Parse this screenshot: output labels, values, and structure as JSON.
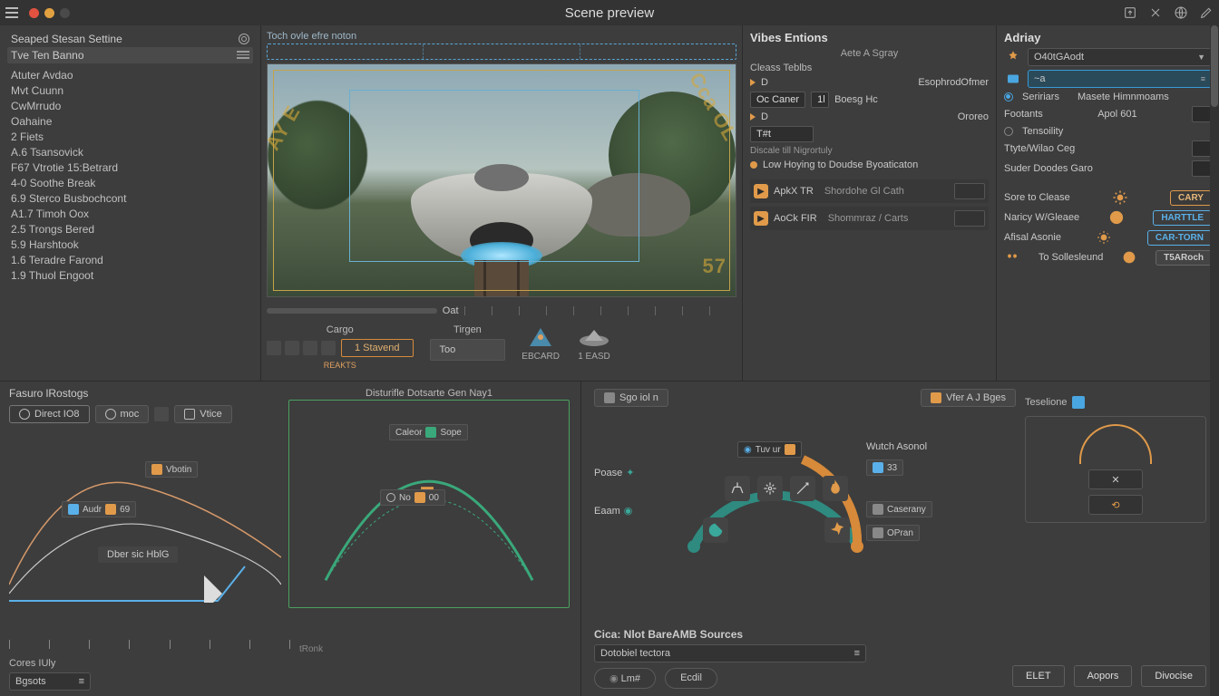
{
  "window": {
    "title": "Scene preview"
  },
  "topbar_icons": [
    "export-icon",
    "settings-icon",
    "globe-icon",
    "edit-icon"
  ],
  "sidebar": {
    "header": "Seaped Stesan Settine",
    "selected": "Tve Ten Banno",
    "items": [
      "Atuter Avdao",
      "Mvt Cuunn",
      "CwMrrudo",
      "Oahaine",
      "2 Fiets",
      "A.6 Tsansovick",
      "F67 Vtrotie 15:Betrard",
      "4-0 Soothe Break",
      "6.9 Sterco Busbochcont",
      "A1.7 Timoh Oox",
      "2.5 Trongs Bered",
      "5.9 Harshtook",
      "1.6 Teradre Farond",
      "1.9 Thuol Engoot"
    ]
  },
  "preview": {
    "caption": "Toch ovle efre noton",
    "out_label": "Oat",
    "watermark_left": "AY E",
    "watermark_right": "Cca OL",
    "watermark_br": "57",
    "switch1": {
      "label": "Cargo",
      "pill": "1 Stavend",
      "sub": "REAKTS"
    },
    "switch2": {
      "label": "Tirgen",
      "pill": "Too"
    },
    "thumbs": [
      {
        "name": "drone-a-thumb",
        "label": "EBCARD"
      },
      {
        "name": "drone-b-thumb",
        "label": "1 EASD"
      }
    ]
  },
  "vibes": {
    "title": "Vibes Entions",
    "sub": "Aete A Sgray",
    "sh": "Cleass Teblbs",
    "row_d": "D",
    "row_d_name": "EsophrodOfmer",
    "input": "Oc Caner",
    "input_num": "1l",
    "input_label": "Boesg Hc",
    "row2_d": "D",
    "row2_name": "Ororeo",
    "row3_field": "T#t",
    "row3_note": "Discale till Nigrortuly",
    "low": "Low Hoying to Doudse Byoaticaton",
    "apix": {
      "code": "ApkX TR",
      "text": "Shordohe Gl Cath"
    },
    "aook": {
      "code": "AoCk FIR",
      "text": "Shommraz / Carts"
    }
  },
  "right": {
    "title": "Adriay",
    "dd1": "O40tGAodt",
    "dd2": "~a",
    "radio1": "Seririars",
    "radio1b": "Masete Himnmoams",
    "foot_lbl": "Footants",
    "foot_val": "Apol 601",
    "radio2": "Tensoility",
    "line1": "Ttyte/Wilao Ceg",
    "line2": "Suder Doodes Garo",
    "rows": [
      {
        "label": "Sore to Clease",
        "tag": "CARY",
        "style": "or"
      },
      {
        "label": "Naricy W/Gleaee",
        "tag": "HARTTLE",
        "style": "bl"
      },
      {
        "label": "Afisal Asonie",
        "tag": "CAR-TORN",
        "style": "bl"
      },
      {
        "label": "To Sollesleund",
        "tag": "T5ARoch",
        "style": "gr"
      }
    ]
  },
  "lowerLeft": {
    "title": "Fasuro lRostogs",
    "tabs": [
      {
        "label": "Direct IO8",
        "active": true
      },
      {
        "label": "moc",
        "active": false
      },
      {
        "label": "Vtice",
        "active": false
      }
    ],
    "g2_title": "Disturifle Dotsarte Gen Nay1",
    "g2_pill1": "Caleor",
    "g2_pill2": "Sope",
    "node_v": "Vbotin",
    "node_a": "Audr",
    "node_a_val": "69",
    "node_no": "No",
    "node_no_val": "00",
    "big": "Dber sic HblG",
    "axis_lbl": "tRonk"
  },
  "lowerRight": {
    "tab1": "Sgo iol n",
    "tab2": "Vfer A J Bges",
    "pill_play": "Tuv ur",
    "lab_p": "Poase",
    "lab_e": "Eaam",
    "lab_wa": "Wutch Asonol",
    "lab_wn": "33",
    "lab_c": "Caserany",
    "lab_o": "OPran",
    "side_title": "Teselione",
    "src_title": "Cica: Nlot BareAMB Sources",
    "src_dd": "Dotobiel tectora",
    "src_link": "Lm#",
    "src_edit": "Ecdil"
  },
  "footer": {
    "b1": "ELET",
    "b2": "Aopors",
    "b3": "Divocise"
  },
  "corner": {
    "title": "Cores IUly",
    "dd": "Bgsots"
  }
}
